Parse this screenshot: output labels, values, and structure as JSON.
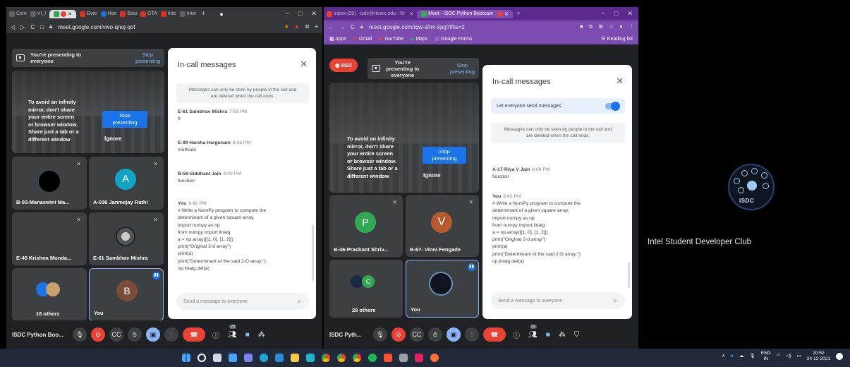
{
  "left": {
    "tabs": [
      "Com",
      "VI_I",
      "",
      "Ever",
      "Han",
      "Basi",
      "GTA",
      "Inte",
      "Inter"
    ],
    "tab_colors": [
      "#5f6368",
      "#5f6368",
      "#34a853",
      "#d93025",
      "#1a73e8",
      "#d93025",
      "#d93025",
      "#d93025",
      "#5f6368"
    ],
    "url": "meet.google.com/vwo-qnoj-qof",
    "presenting": {
      "line1": "You're presenting to",
      "line2": "everyone",
      "stop": "Stop\npresenting"
    },
    "mirror": {
      "text": "To avoid an infinity\nmirror, don't share\nyour entire screen\nor browser window.\nShare just a tab or a\ndifferent window",
      "stop": "Stop\npresenting",
      "ignore": "Ignore"
    },
    "tiles": [
      {
        "name": "B-03-Manaswini Ma...",
        "avatar_color": "#000000"
      },
      {
        "name": "A-036 Janmejay Rathi",
        "initial": "A",
        "avatar_color": "#12a4c4"
      },
      {
        "name": "E-45 Krishna Munda..."
      },
      {
        "name": "E-61 Sambhav Mishra"
      },
      {
        "name": "16 others"
      },
      {
        "name": "You",
        "initial": "B",
        "avatar_color": "#7a4d3a"
      }
    ],
    "panel": {
      "title": "In-call messages",
      "note": "Messages can only be seen by people in the call and\nare deleted when the call ends.",
      "messages": [
        {
          "who": "E-61 Sambhav Mishra",
          "time": "7:59 PM",
          "text": "9"
        },
        {
          "who": "E-09 Harsha Hargunani",
          "time": "8:06 PM",
          "text": "methods"
        },
        {
          "who": "B-56-Siddhant Jain",
          "time": "8:09 PM",
          "text": "function"
        },
        {
          "who": "You",
          "time": "8:42 PM",
          "text": "# Write a NumPy program to compute the\ndeterminant of a given square array.\nimport numpy as np\nfrom numpy import linalg\na = np.array([[1, 0], [1, 2]])\nprint(\"Original 2-d array\")\nprint(a)\nprint(\"Determinant of the said 2-D array:\")\nnp.linalg.det(a)"
        }
      ],
      "input": "Send a message to everyone"
    },
    "bar": {
      "name": "ISDC Python Boo...",
      "people_count": "23"
    }
  },
  "right": {
    "tabs": [
      "Inbox (29) - isdc@rknec.edu - Kr",
      "Meet - ISDC Python Bootcam"
    ],
    "url": "meet.google.com/tqw-sfrm-kpg?lfhs=2",
    "bookmarks": [
      "Apps",
      "Gmail",
      "YouTube",
      "Maps",
      "Google Forms"
    ],
    "reading_list": "Reading list",
    "rec": "REC",
    "presenting": {
      "line1": "You're",
      "line2": "presenting to",
      "line3": "everyone",
      "stop": "Stop\npresenting"
    },
    "mirror": {
      "text": "To avoid an infinity\nmirror, don't share\nyour entire screen\nor browser window.\nShare just a tab or a\ndifferent window",
      "stop": "Stop\npresenting",
      "ignore": "Ignore"
    },
    "tiles": [
      {
        "name": "B-46-Prashant Shriv...",
        "initial": "P",
        "avatar_color": "#33a852"
      },
      {
        "name": "B-67- Vinni Fengade",
        "initial": "V",
        "avatar_color": "#b5592e"
      },
      {
        "name": "28 others"
      },
      {
        "name": "You"
      }
    ],
    "panel": {
      "title": "In-call messages",
      "toggle": "Let everyone send messages",
      "note": "Messages can only be seen by people in the call and\nare deleted when the call ends.",
      "messages": [
        {
          "who": "A-17-Riya V Jain",
          "time": "8:09 PM",
          "text": "function"
        },
        {
          "who": "You",
          "time": "8:42 PM",
          "text": "# Write a NumPy program to compute the\ndeterminant of a given square array.\nimport numpy as np\nfrom numpy import linalg\na = np.array([[1, 0], [1, 2]])\nprint(\"Original 2-d array\")\nprint(a)\nprint(\"Determinant of the said 2-D array:\")\nnp.linalg.det(a)"
        }
      ],
      "input": "Send a message to everyone"
    },
    "bar": {
      "name": "ISDC Pyth...",
      "people_count": "32"
    }
  },
  "side": {
    "logo_text": "ISDC",
    "club": "Intel Student Developer Club"
  },
  "taskbar": {
    "lang": "ENG",
    "region": "IN",
    "time": "20:50",
    "date": "24-12-2021"
  }
}
